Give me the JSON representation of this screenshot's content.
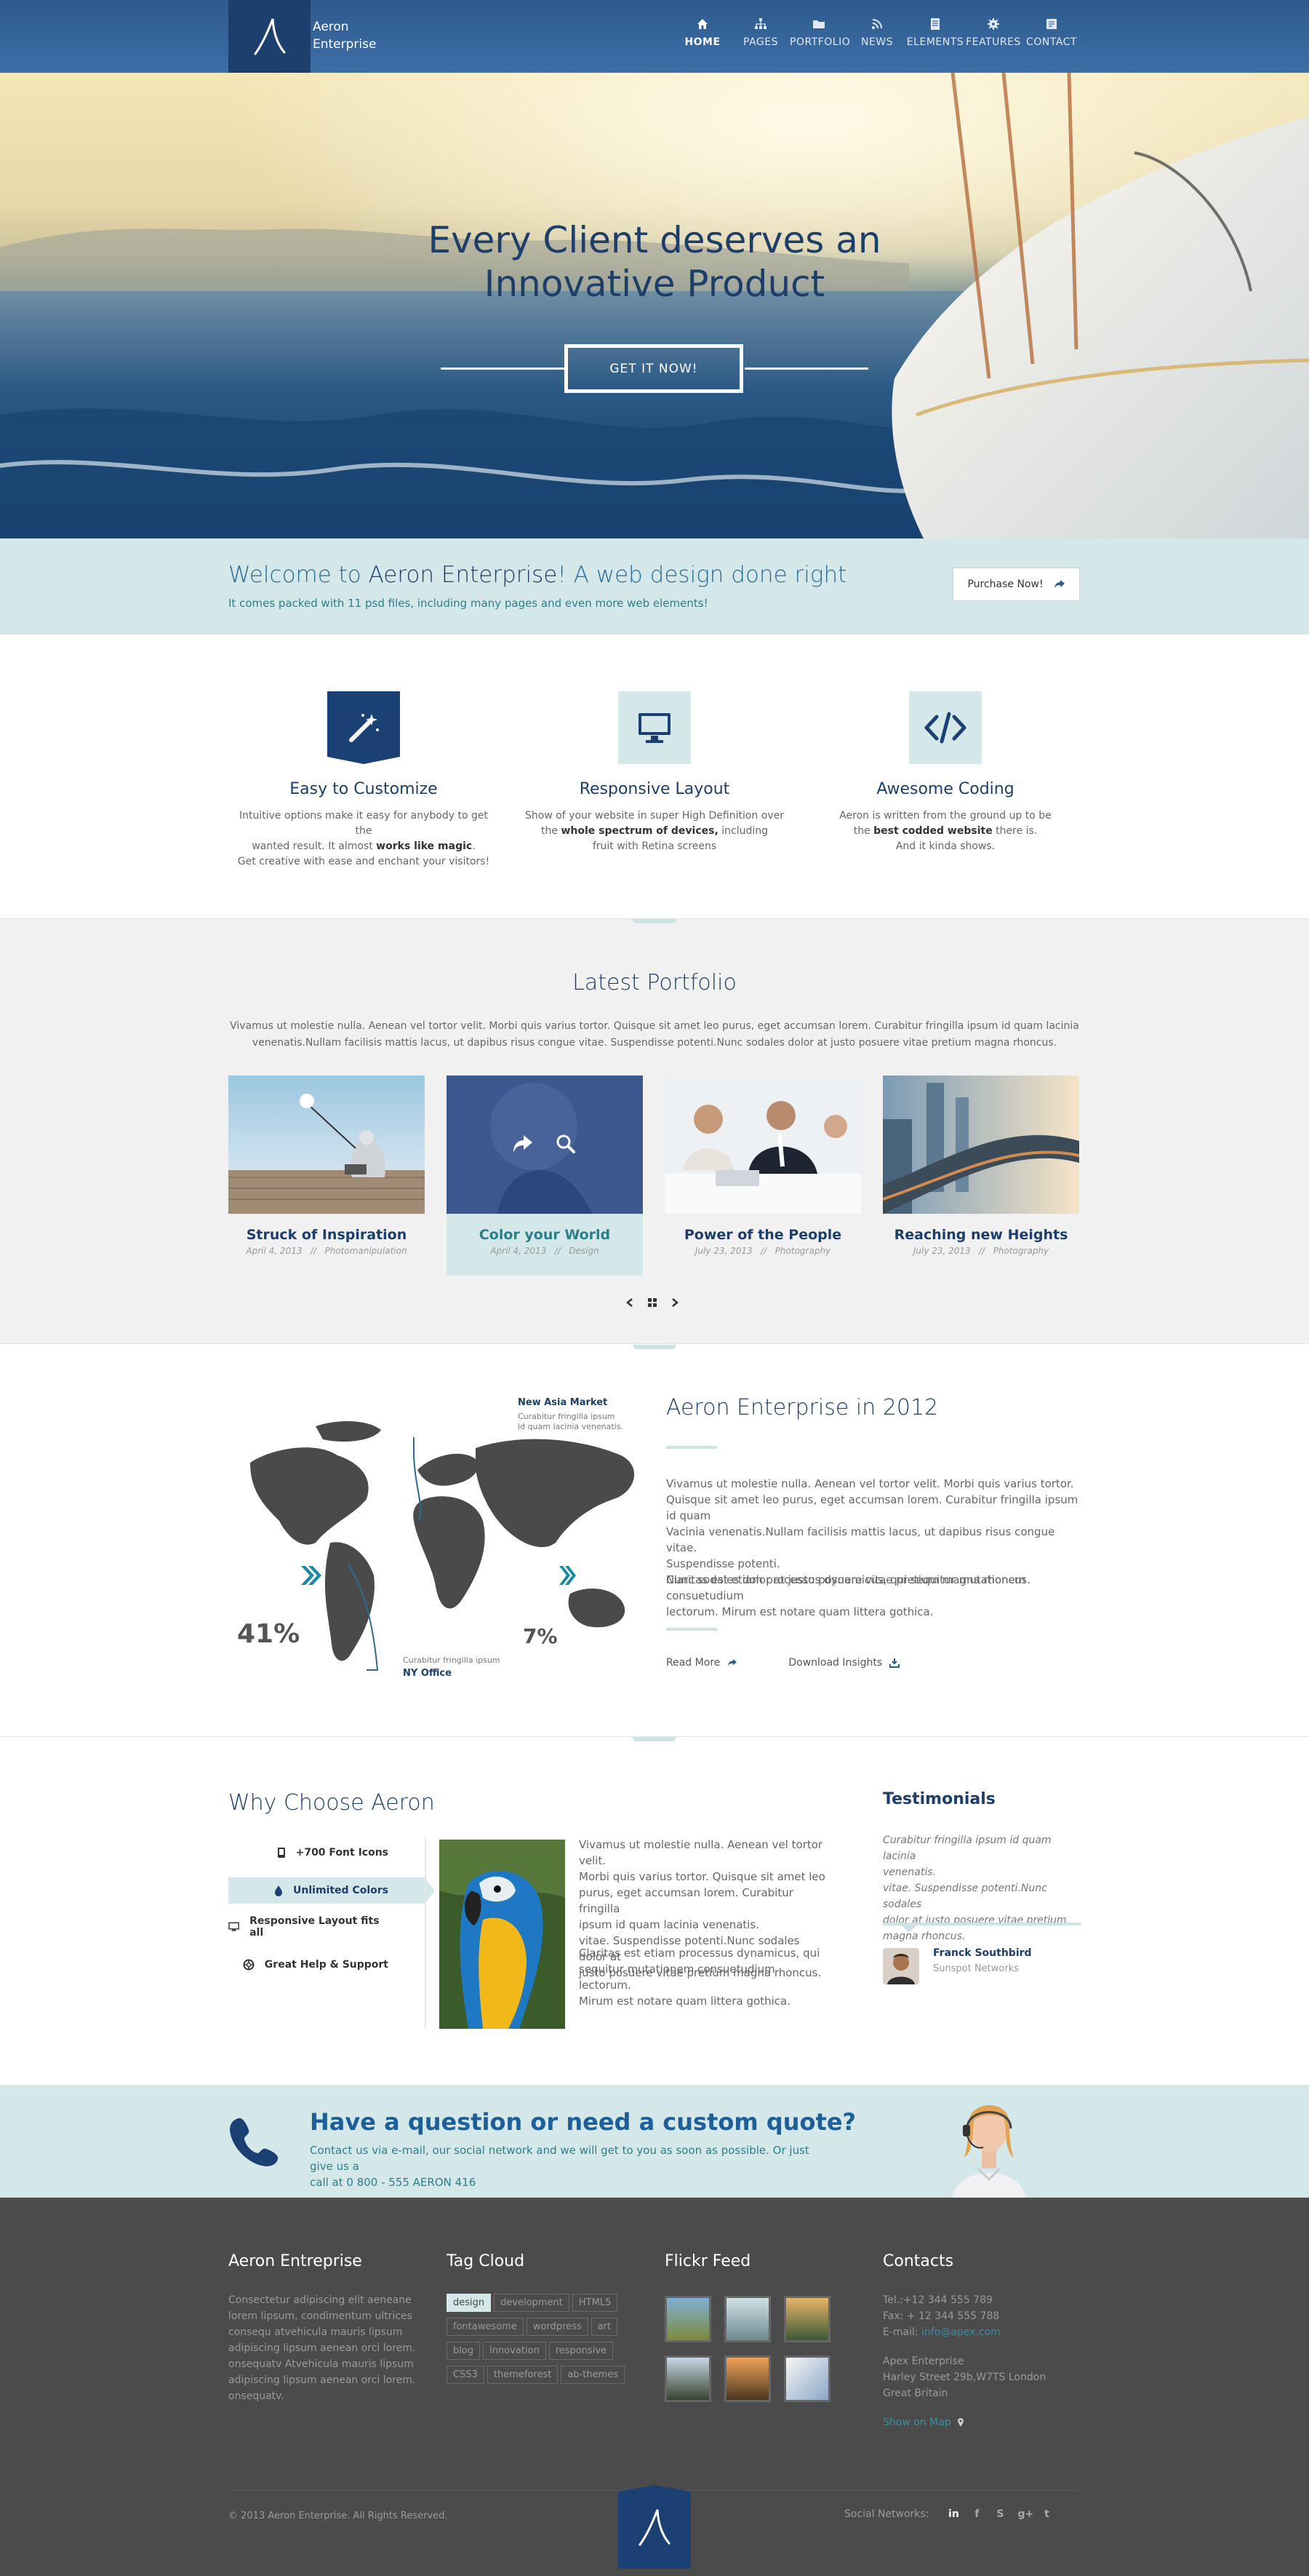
{
  "brand": {
    "name_line1": "Aeron",
    "name_line2": "Enterprise"
  },
  "nav": [
    {
      "label": "HOME",
      "icon": "home-icon",
      "active": true
    },
    {
      "label": "PAGES",
      "icon": "sitemap-icon"
    },
    {
      "label": "PORTFOLIO",
      "icon": "folder-icon"
    },
    {
      "label": "NEWS",
      "icon": "rss-icon"
    },
    {
      "label": "ELEMENTS",
      "icon": "file-icon"
    },
    {
      "label": "FEATURES",
      "icon": "gear-icon"
    },
    {
      "label": "CONTACT",
      "icon": "contact-card-icon"
    }
  ],
  "hero": {
    "title_line1": "Every Client deserves an",
    "title_line2": "Innovative Product",
    "button": "GET IT NOW!"
  },
  "welcome": {
    "title_pre": "Welcome to ",
    "title_brand": "Aeron Enterprise",
    "title_post": "! A web design done right",
    "subtitle": "It comes packed with 11 psd files, including many pages and even more web elements!",
    "button": "Purchase Now!"
  },
  "features": [
    {
      "title": "Easy to Customize",
      "icon": "magic-wand-icon",
      "line1": "Intuitive options make it easy for anybody to get the",
      "line2_pre": "wanted result. It almost ",
      "line2_bold": "works like magic",
      "line2_post": ".",
      "line3": "Get creative with ease and enchant your visitors!"
    },
    {
      "title": "Responsive Layout",
      "icon": "monitor-icon",
      "line1": "Show of your website in super High Definition over",
      "line2_pre": "the ",
      "line2_bold": "whole spectrum of devices,",
      "line2_post": " including",
      "line3": "fruit with Retina screens"
    },
    {
      "title": "Awesome Coding",
      "icon": "code-icon",
      "line1": "Aeron is written from the ground up to be",
      "line2_pre": "the ",
      "line2_bold": "best codded website",
      "line2_post": " there is.",
      "line3": "And it kinda shows."
    }
  ],
  "portfolio": {
    "title": "Latest Portfolio",
    "text": "Vivamus ut molestie nulla. Aenean vel tortor velit. Morbi quis varius tortor. Quisque sit amet leo purus, eget accumsan lorem. Curabitur fringilla ipsum id quam lacinia venenatis.Nullam facilisis mattis lacus, ut dapibus risus congue vitae. Suspendisse potenti.Nunc sodales dolor at justo posuere vitae pretium magna rhoncus.",
    "items": [
      {
        "title": "Struck of Inspiration",
        "date": "April 4, 2013",
        "sep": "//",
        "category": "Photomanipulation"
      },
      {
        "title": "Color your World",
        "date": "April 4, 2013",
        "sep": "//",
        "category": "Design"
      },
      {
        "title": "Power of the People",
        "date": "July 23, 2013",
        "sep": "//",
        "category": "Photography"
      },
      {
        "title": "Reaching new Heights",
        "date": "July 23, 2013",
        "sep": "//",
        "category": "Photography"
      }
    ]
  },
  "about": {
    "map_label_asia_title": "New Asia Market",
    "map_label_asia_text1": "Curabitur fringilla ipsum",
    "map_label_asia_text2": "id quam lacinia venenatis.",
    "map_label_ny_text": "Curabitur fringilla ipsum",
    "map_label_ny_title": "NY Office",
    "stat_left": "41%",
    "stat_right": "7%",
    "title": "Aeron Enterprise in 2012",
    "p1_l1": "Vivamus ut molestie nulla. Aenean vel tortor velit. Morbi quis varius tortor.",
    "p1_l2": "Quisque sit amet leo purus, eget accumsan lorem. Curabitur fringilla ipsum id quam",
    "p1_l3": "Vacinia venenatis.Nullam facilisis mattis lacus, ut dapibus risus congue vitae.",
    "p1_l4": "Suspendisse potenti.",
    "p1_l5": "Nunc sodales dolor at justo posuere vitae pretium magna rhoncus.",
    "p2_l1": "Claritas est etiam processus dynamicus, qui sequitur mutationem consuetudium",
    "p2_l2": "lectorum. Mirum est notare quam littera gothica.",
    "read_more": "Read More",
    "download": "Download Insights"
  },
  "why": {
    "title": "Why Choose Aeron",
    "tabs": [
      {
        "label": "+700 Font Icons",
        "icon": "mobile-icon"
      },
      {
        "label": "Unlimited Colors",
        "icon": "drop-icon",
        "active": true
      },
      {
        "label": "Responsive Layout fits all",
        "icon": "monitor-icon"
      },
      {
        "label": "Great Help & Support",
        "icon": "lifebuoy-icon"
      }
    ],
    "p1_l1": "Vivamus ut molestie nulla. Aenean vel tortor velit.",
    "p1_l2": "Morbi quis varius tortor. Quisque sit amet leo",
    "p1_l3": "purus, eget accumsan lorem. Curabitur fringilla",
    "p1_l4": "ipsum id quam lacinia venenatis.",
    "p1_l5": "vitae. Suspendisse potenti.Nunc sodales dolor at",
    "p1_l6": "justo posuere vitae pretium magna rhoncus.",
    "p2_l1": "Claritas est etiam processus dynamicus, qui",
    "p2_l2": "sequitur mutationem consuetudium lectorum.",
    "p2_l3": "Mirum est notare quam littera gothica."
  },
  "testimonials": {
    "title": "Testimonials",
    "q1": "Curabitur fringilla ipsum id quam lacinia",
    "q2": "venenatis.",
    "q3": "vitae. Suspendisse potenti.Nunc sodales",
    "q4": "dolor at justo posuere vitae pretium",
    "q5": "magna rhoncus.",
    "name": "Franck Southbird",
    "company": "Sunspot Networks"
  },
  "quote": {
    "title": "Have a question or need a custom quote?",
    "line1": "Contact us via e-mail, our social network and we will get to you as soon as possible. Or just give us a",
    "line2": "call at 0 800 - 555 AERON 416"
  },
  "footer": {
    "about_title": "Aeron Entreprise",
    "about_lines": [
      "Consectetur adipiscing elit aeneane",
      "lorem lipsum, condimentum ultrices",
      "consequ atvehicula mauris lipsum",
      "adipiscing lipsum aenean orci lorem.",
      "onsequatv Atvehicula mauris lipsum",
      "adipiscing lipsum aenean orci lorem.",
      "onsequatv."
    ],
    "tags_title": "Tag Cloud",
    "tags": [
      [
        "design",
        "development",
        "HTML5"
      ],
      [
        "fontawesome",
        "wordpress",
        "art"
      ],
      [
        "blog",
        "innovation",
        "responsive"
      ],
      [
        "CSS3",
        "themeforest",
        "ab-themes"
      ]
    ],
    "flickr_title": "Flickr Feed",
    "contacts_title": "Contacts",
    "tel": "Tel.:+12 344 555 789",
    "fax": "Fax: + 12 344 555 788",
    "email_label": "E-mail: ",
    "email": "info@apex.com",
    "company": "Apex Enterprise",
    "address1": "Harley Street 29b,W7TS London",
    "address2": "Great Britain",
    "map_link": "Show on Map",
    "copyright": "© 2013 Aeron Enterprise. All Rights Reserved.",
    "social_label": "Social Networks:"
  },
  "colors": {
    "primary": "#1b4073",
    "accent": "#d4e8e9",
    "footer": "#4b4b4b"
  }
}
